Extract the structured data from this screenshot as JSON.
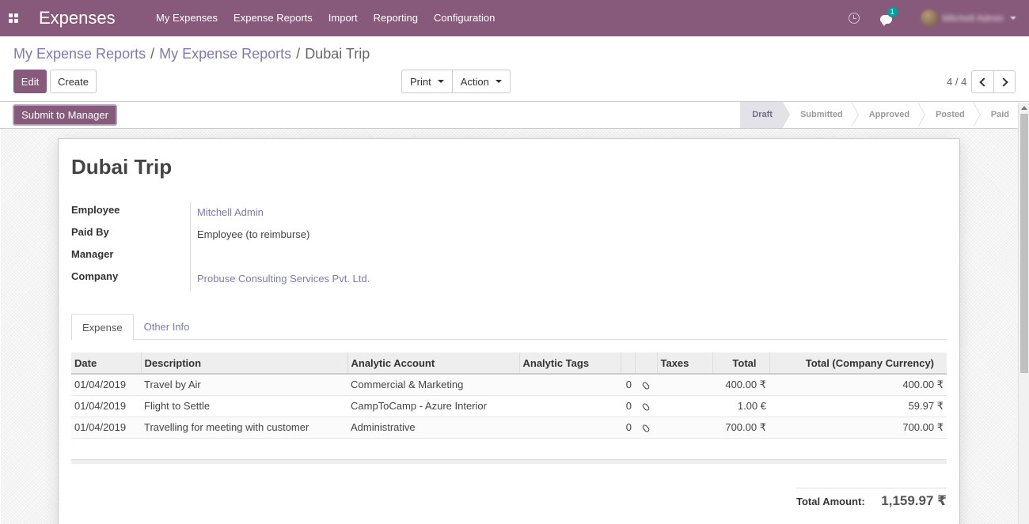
{
  "navbar": {
    "app_title": "Expenses",
    "menu": [
      "My Expenses",
      "Expense Reports",
      "Import",
      "Reporting",
      "Configuration"
    ],
    "chat_badge": "1",
    "user_name": "Mitchell Admin"
  },
  "breadcrumb": {
    "items": [
      "My Expense Reports",
      "My Expense Reports"
    ],
    "current": "Dubai Trip",
    "separator": "/"
  },
  "toolbar": {
    "edit_label": "Edit",
    "create_label": "Create",
    "print_label": "Print",
    "action_label": "Action",
    "pager_value": "4 / 4"
  },
  "statusbar": {
    "submit_label": "Submit to Manager",
    "stages": [
      "Draft",
      "Submitted",
      "Approved",
      "Posted",
      "Paid"
    ],
    "current_stage": "Draft"
  },
  "form": {
    "title": "Dubai Trip",
    "fields": [
      {
        "label": "Employee",
        "value": "Mitchell Admin",
        "link": true
      },
      {
        "label": "Paid By",
        "value": "Employee (to reimburse)",
        "link": false
      },
      {
        "label": "Manager",
        "value": "",
        "link": false
      },
      {
        "label": "Company",
        "value": "Probuse Consulting Services Pvt. Ltd.",
        "link": true
      }
    ],
    "tabs": [
      "Expense",
      "Other Info"
    ],
    "table": {
      "columns": [
        "Date",
        "Description",
        "Analytic Account",
        "Analytic Tags",
        "",
        "",
        "Taxes",
        "Total",
        "Total (Company Currency)"
      ],
      "rows": [
        [
          "01/04/2019",
          "Travel by Air",
          "Commercial & Marketing",
          "",
          "0",
          "",
          "",
          "400.00 ₹",
          "400.00 ₹"
        ],
        [
          "01/04/2019",
          "Flight to Settle",
          "CampToCamp - Azure Interior",
          "",
          "0",
          "",
          "",
          "1.00 €",
          "59.97 ₹"
        ],
        [
          "01/04/2019",
          "Travelling for meeting with customer",
          "Administrative",
          "",
          "0",
          "",
          "",
          "700.00 ₹",
          "700.00 ₹"
        ]
      ]
    },
    "total_label": "Total Amount:",
    "total_value": "1,159.97 ₹"
  },
  "colors": {
    "brand": "#875a7b",
    "link": "#7c7bad"
  }
}
